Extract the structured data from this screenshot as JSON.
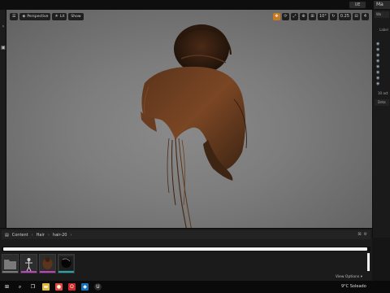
{
  "topbar": {
    "badge": "UE",
    "window_tab": "Ma"
  },
  "left_rail": {
    "icons": [
      "chevron-right-icon",
      "panel-icon"
    ]
  },
  "viewport": {
    "left_tools": [
      {
        "glyph": "☰",
        "label": ""
      },
      {
        "glyph": "◈",
        "label": "Perspective"
      },
      {
        "glyph": "☀",
        "label": "Lit"
      },
      {
        "glyph": "",
        "label": "Show"
      }
    ],
    "right_tools": [
      "✥",
      "⟳",
      "⤢",
      "⊕",
      "⊞",
      "10°",
      "↻",
      "0.25",
      "⊟",
      "4"
    ],
    "active_tool_index": 0
  },
  "right_panel": {
    "tab": "Wo",
    "label": "Label",
    "eyes": 8,
    "count": "10 act",
    "details_tab": "Deta"
  },
  "content_browser": {
    "path": [
      "Content",
      "Hair",
      "hair-20"
    ],
    "view_options": "View Options ▾",
    "tiles": [
      {
        "name": "folder",
        "color": "#7a7a7a",
        "bar": "#7a7a7a"
      },
      {
        "name": "skeleton",
        "color": "#3a3a3a",
        "bar": "#c040c0"
      },
      {
        "name": "groom",
        "color": "#3a3a3a",
        "bar": "#c040c0"
      },
      {
        "name": "texture",
        "color": "#1c1c1c",
        "bar": "#20a8a8"
      }
    ]
  },
  "taskbar": {
    "icons": [
      {
        "name": "start-icon",
        "glyph": "⊞",
        "color": "#0b0b0b"
      },
      {
        "name": "search-icon",
        "glyph": "⌕",
        "color": "#0b0b0b"
      },
      {
        "name": "task-view-icon",
        "glyph": "❐",
        "color": "#0b0b0b"
      },
      {
        "name": "file-explorer-icon",
        "glyph": "▬",
        "color": "#e3b83a"
      },
      {
        "name": "chrome-icon",
        "glyph": "●",
        "color": "#e04a3a"
      },
      {
        "name": "opera-icon",
        "glyph": "O",
        "color": "#d0282b"
      },
      {
        "name": "app-icon",
        "glyph": "◆",
        "color": "#1a6fb5"
      },
      {
        "name": "unreal-icon",
        "glyph": "U",
        "color": "#2a2a2a"
      }
    ],
    "tray_text": "9°C Soleado"
  }
}
